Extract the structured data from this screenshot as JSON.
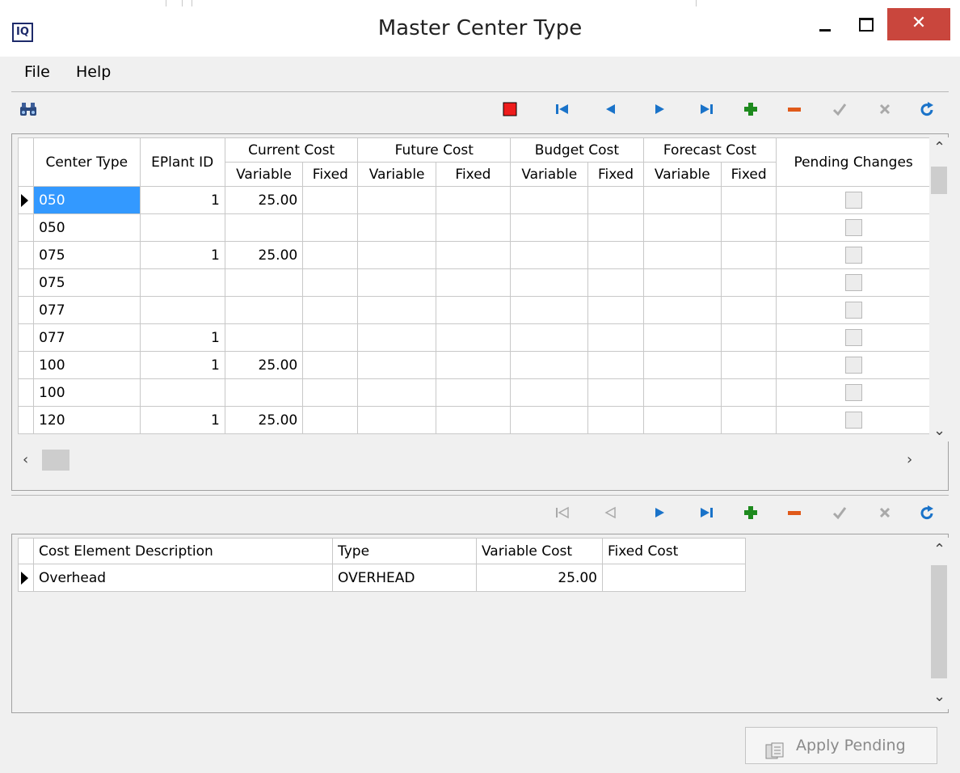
{
  "window": {
    "title": "Master Center Type",
    "app_icon_text": "IQ",
    "close_glyph": "✕"
  },
  "menu": [
    "File",
    "Help"
  ],
  "toolbar_top": {
    "icons": [
      "binoculars-icon",
      "stop-icon",
      "first-record-icon",
      "prior-record-icon",
      "next-record-icon",
      "last-record-icon",
      "insert-icon",
      "delete-icon",
      "post-icon",
      "cancel-icon",
      "refresh-icon"
    ]
  },
  "grid1": {
    "headers": {
      "center_type": "Center Type",
      "eplant_id": "EPlant ID",
      "current_cost": "Current Cost",
      "future_cost": "Future Cost",
      "budget_cost": "Budget Cost",
      "forecast_cost": "Forecast Cost",
      "pending_changes": "Pending Changes",
      "variable": "Variable",
      "fixed": "Fixed"
    },
    "rows": [
      {
        "center_type": "050",
        "eplant_id": "1",
        "current_variable": "25.00"
      },
      {
        "center_type": "050",
        "eplant_id": "",
        "current_variable": ""
      },
      {
        "center_type": "075",
        "eplant_id": "1",
        "current_variable": "25.00"
      },
      {
        "center_type": "075",
        "eplant_id": "",
        "current_variable": ""
      },
      {
        "center_type": "077",
        "eplant_id": "",
        "current_variable": ""
      },
      {
        "center_type": "077",
        "eplant_id": "1",
        "current_variable": ""
      },
      {
        "center_type": "100",
        "eplant_id": "1",
        "current_variable": "25.00"
      },
      {
        "center_type": "100",
        "eplant_id": "",
        "current_variable": ""
      },
      {
        "center_type": "120",
        "eplant_id": "1",
        "current_variable": "25.00"
      }
    ]
  },
  "grid2": {
    "headers": {
      "description": "Cost Element Description",
      "type": "Type",
      "variable_cost": "Variable Cost",
      "fixed_cost": "Fixed Cost"
    },
    "rows": [
      {
        "description": "Overhead",
        "type": "OVERHEAD",
        "variable_cost": "25.00",
        "fixed_cost": ""
      }
    ]
  },
  "apply_button": {
    "label": "Apply Pending"
  }
}
